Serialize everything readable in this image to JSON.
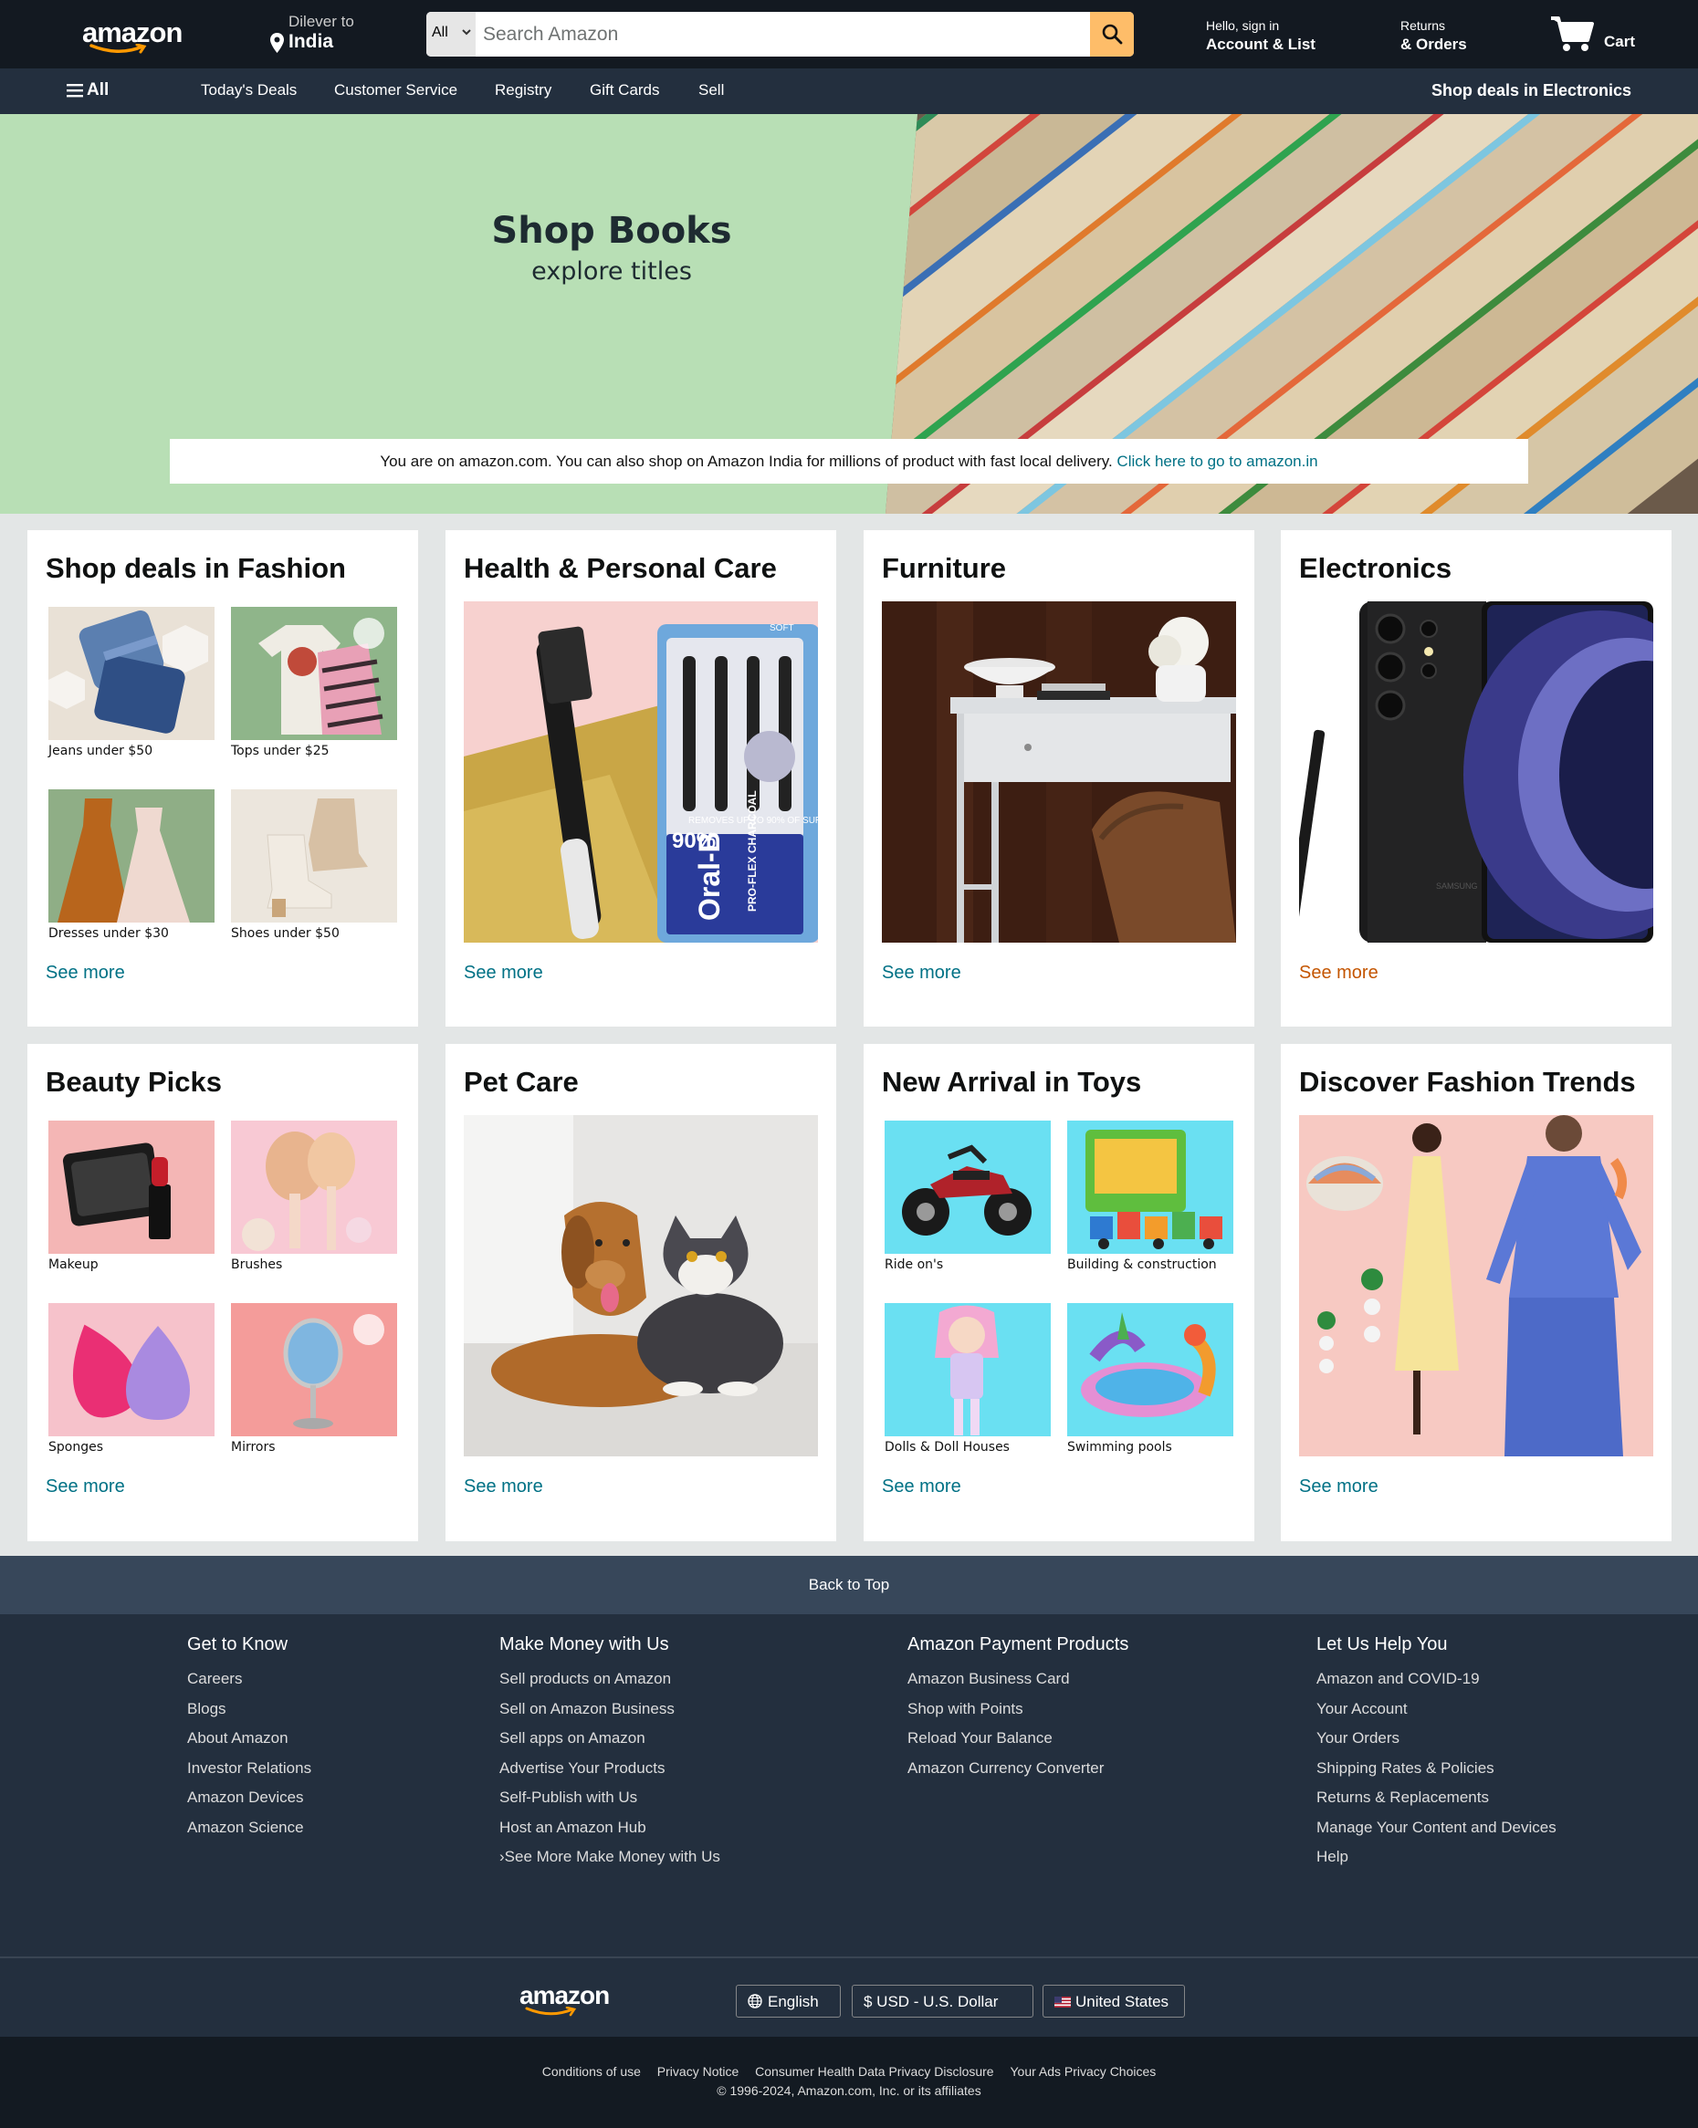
{
  "header": {
    "logo": "amazon",
    "deliver_line1": "Dilever to",
    "deliver_line2": "India",
    "search_category": "All",
    "search_placeholder": "Search Amazon",
    "account_line1": "Hello, sign in",
    "account_line2": "Account & List",
    "orders_line1": "Returns",
    "orders_line2": "& Orders",
    "cart_label": "Cart"
  },
  "nav": {
    "all": "All",
    "items": [
      "Today's Deals",
      "Customer Service",
      "Registry",
      "Gift Cards",
      "Sell"
    ],
    "right": "Shop deals in Electronics"
  },
  "hero": {
    "title": "Shop Books",
    "subtitle": "explore titles",
    "notice_text": "You are on amazon.com. You can also shop on Amazon India for millions of product with fast local delivery. ",
    "notice_link": "Click here to go to amazon.in"
  },
  "cards": [
    {
      "title": "Shop deals in Fashion",
      "see_more": "See more",
      "items": [
        "Jeans under $50",
        "Tops under $25",
        "Dresses under $30",
        "Shoes under $50"
      ]
    },
    {
      "title": "Health & Personal Care",
      "see_more": "See more"
    },
    {
      "title": "Furniture",
      "see_more": "See more"
    },
    {
      "title": "Electronics",
      "see_more": "See more"
    },
    {
      "title": "Beauty Picks",
      "see_more": "See more",
      "items": [
        "Makeup",
        "Brushes",
        "Sponges",
        "Mirrors"
      ]
    },
    {
      "title": "Pet Care",
      "see_more": "See more"
    },
    {
      "title": "New Arrival in Toys",
      "see_more": "See more",
      "items": [
        "Ride on's",
        "Building & construction",
        "Dolls & Doll Houses",
        "Swimming pools"
      ]
    },
    {
      "title": "Discover Fashion Trends",
      "see_more": "See more"
    }
  ],
  "product_text": {
    "oral_b": "Oral-B",
    "oral_b_line": "PRO-FLEX CHARCOAL",
    "oral_b_badge": "90%",
    "oral_b_badge_caption": "REMOVES UP TO 90% OF SURFACE STAINS",
    "oral_b_soft": "SOFT",
    "samsung": "SAMSUNG"
  },
  "footer": {
    "back_to_top": "Back to Top",
    "columns": [
      {
        "title": "Get to Know",
        "links": [
          "Careers",
          "Blogs",
          "About Amazon",
          "Investor Relations",
          "Amazon Devices",
          "Amazon Science"
        ]
      },
      {
        "title": "Make Money with Us",
        "links": [
          "Sell products on Amazon",
          "Sell on Amazon Business",
          "Sell apps on Amazon",
          "Advertise Your Products",
          "Self-Publish with Us",
          "Host an Amazon Hub",
          "›See More Make Money with Us"
        ]
      },
      {
        "title": "Amazon Payment Products",
        "links": [
          "Amazon Business Card",
          "Shop with Points",
          "Reload Your Balance",
          "Amazon Currency Converter"
        ]
      },
      {
        "title": "Let Us Help You",
        "links": [
          "Amazon and COVID-19",
          "Your Account",
          "Your Orders",
          "Shipping Rates & Policies",
          "Returns & Replacements",
          "Manage Your Content and Devices",
          "Help"
        ]
      }
    ],
    "logo": "amazon",
    "language": "English",
    "currency": "$ USD - U.S. Dollar",
    "country": "United States",
    "legal_links": [
      "Conditions of use",
      "Privacy Notice",
      "Consumer Health Data Privacy Disclosure",
      "Your Ads Privacy Choices"
    ],
    "copyright": "© 1996-2024, Amazon.com, Inc. or its affiliates"
  },
  "colors": {
    "header_bg": "#131921",
    "nav_bg": "#232f3e",
    "search_button": "#febd69",
    "link": "#007185",
    "link_hover": "#c45500",
    "hero_bg": "#b8dfb5"
  }
}
